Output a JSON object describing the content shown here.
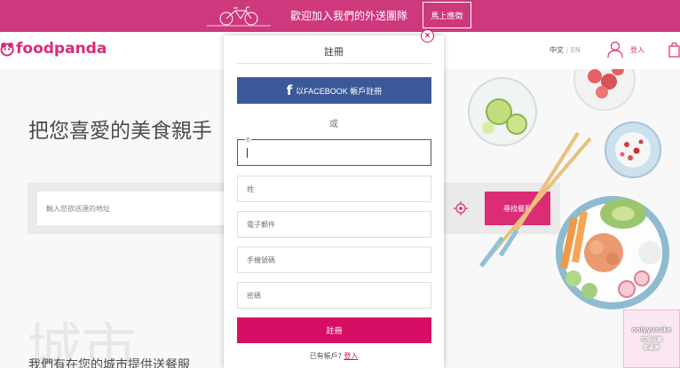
{
  "promo": {
    "message": "歡迎加入我們的外送團隊",
    "cta": "馬上應徵"
  },
  "header": {
    "brand": "foodpanda",
    "lang_zh": "中文",
    "lang_sep": "|",
    "lang_en": "EN",
    "login": "登入"
  },
  "hero": {
    "title": "把您喜愛的美食親手",
    "address_placeholder": "輸入您欲送達的地址",
    "find_button": "尋找餐廳",
    "bg_text": "城市",
    "bottom_text": "我們有在您的城市提供送餐服"
  },
  "watermark": {
    "line1": "onlyyusuke",
    "line2": "吃喝玩樂",
    "line3": "都最高"
  },
  "modal": {
    "close": "×",
    "title": "註冊",
    "facebook_icon": "f",
    "facebook_label": "以FACEBOOK 帳戶註冊",
    "or": "或",
    "first_name_label": "名",
    "last_name_placeholder": "姓",
    "email_placeholder": "電子郵件",
    "phone_placeholder": "手機號碼",
    "password_placeholder": "密碼",
    "submit": "註冊",
    "have_account": "已有帳戶?",
    "login_link": "登入"
  },
  "colors": {
    "brand_pink": "#d70f64",
    "banner_pink": "#c81d6b",
    "facebook_blue": "#3b5998"
  }
}
